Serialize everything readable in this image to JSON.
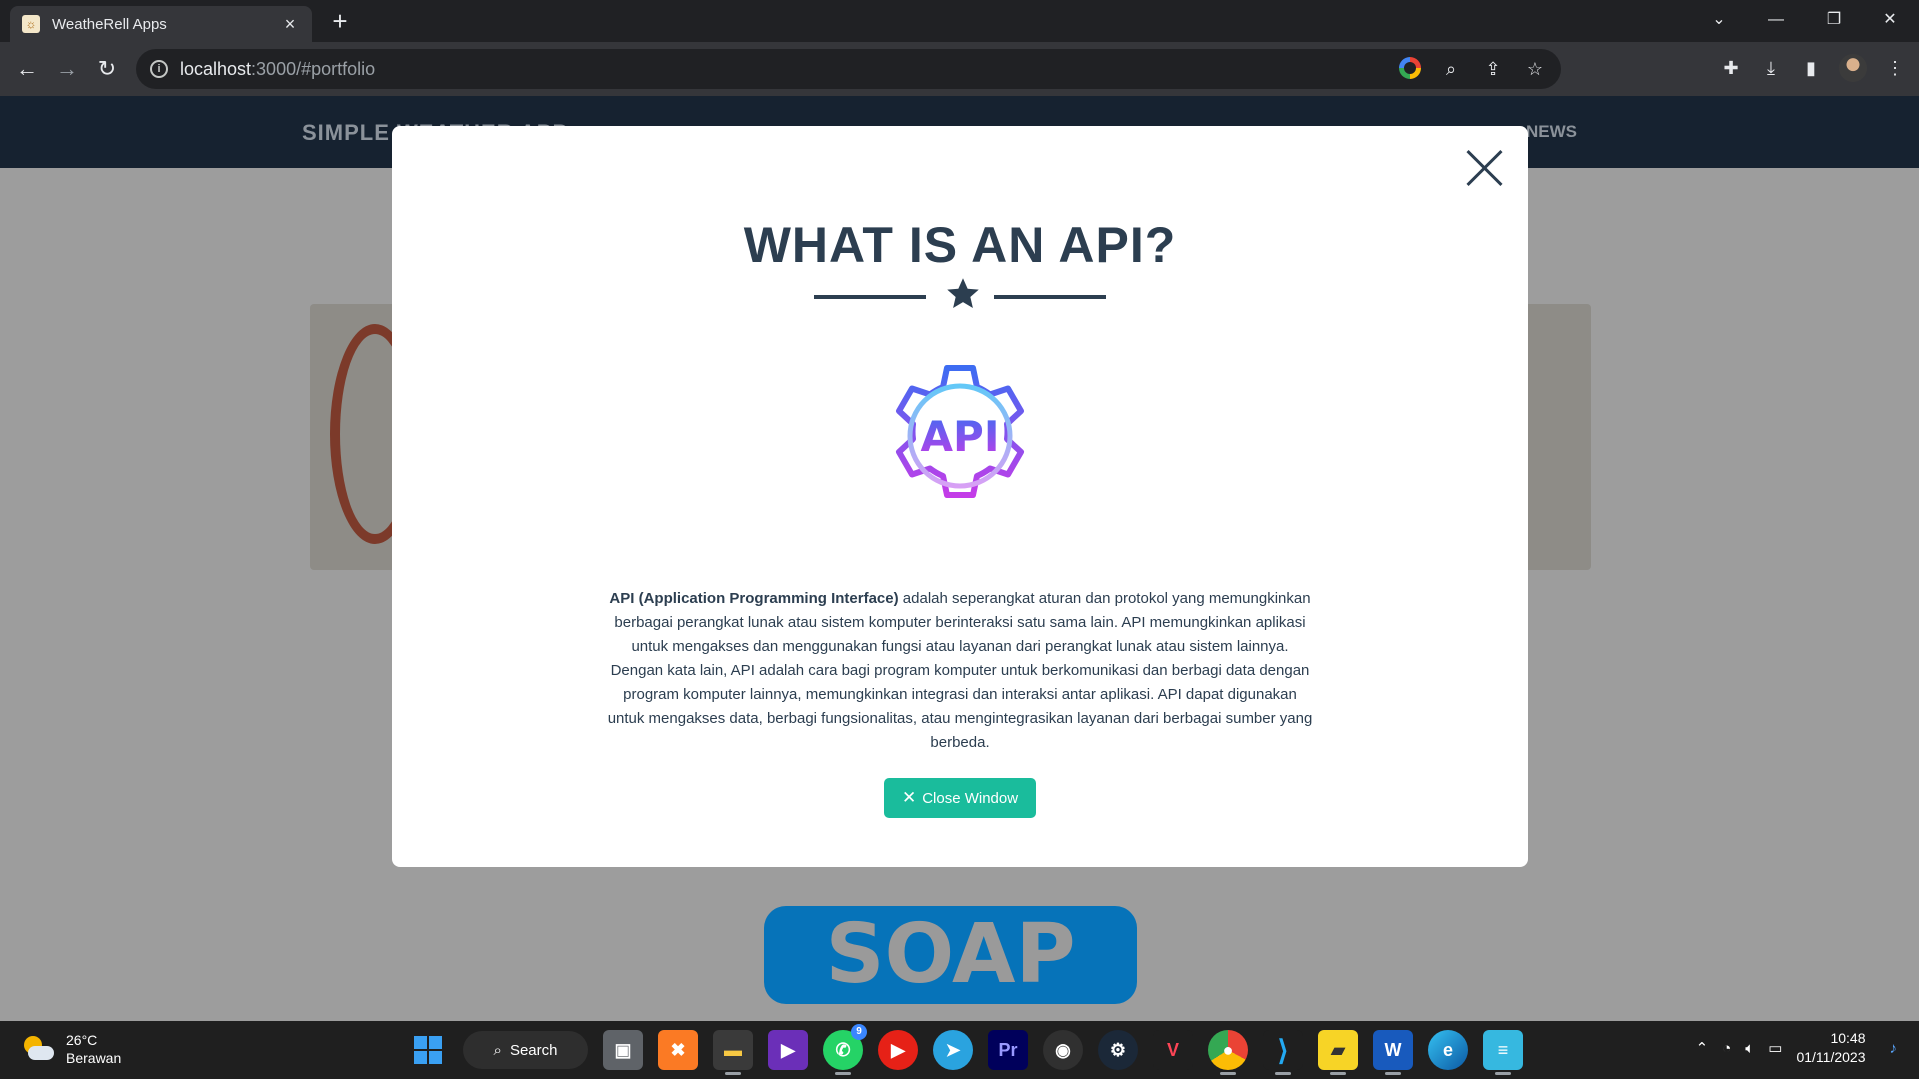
{
  "browser": {
    "tab_title": "WeatheRell Apps",
    "url_host": "localhost",
    "url_rest": ":3000/#portfolio"
  },
  "page": {
    "brand": "SIMPLE WEATHER APP",
    "nav_links": [
      "NEWS"
    ],
    "soap_label": "SOAP"
  },
  "modal": {
    "title": "WHAT IS AN API?",
    "icon_text": "API",
    "body_bold": "API (Application Programming Interface)",
    "body_rest": " adalah seperangkat aturan dan protokol yang memungkinkan berbagai perangkat lunak atau sistem komputer berinteraksi satu sama lain. API memungkinkan aplikasi untuk mengakses dan menggunakan fungsi atau layanan dari perangkat lunak atau sistem lainnya. Dengan kata lain, API adalah cara bagi program komputer untuk berkomunikasi dan berbagi data dengan program komputer lainnya, memungkinkan integrasi dan interaksi antar aplikasi. API dapat digunakan untuk mengakses data, berbagi fungsionalitas, atau mengintegrasikan layanan dari berbagai sumber yang berbeda.",
    "close_button": "Close Window",
    "colors": {
      "title": "#2c3e50",
      "button": "#1abc9c"
    }
  },
  "taskbar": {
    "weather_temp": "26°C",
    "weather_desc": "Berawan",
    "search_label": "Search",
    "whatsapp_badge": "9",
    "clock_time": "10:48",
    "clock_date": "01/11/2023",
    "apps": [
      "file-explorer",
      "xampp",
      "files",
      "visual-studio",
      "whatsapp",
      "youtube-music",
      "telegram",
      "premiere-pro",
      "obs",
      "steam",
      "valorant",
      "chrome",
      "vscode",
      "sticky-notes",
      "word",
      "edge",
      "notepad"
    ]
  }
}
